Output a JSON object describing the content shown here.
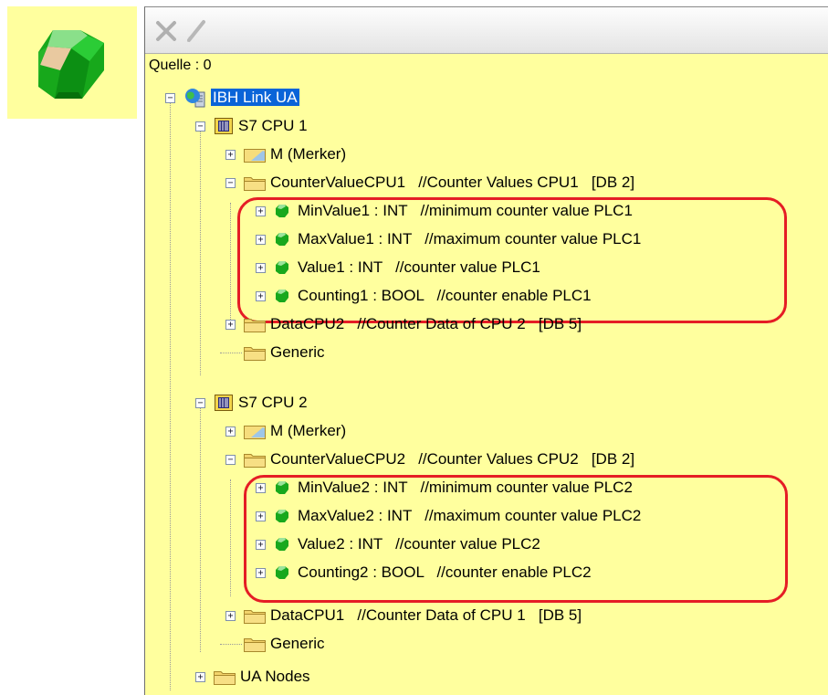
{
  "source": "Quelle : 0",
  "root": {
    "label": "IBH Link UA"
  },
  "cpu1": {
    "label": "S7 CPU 1",
    "merker": "M (Merker)",
    "db": "CounterValueCPU1   //Counter Values CPU1   [DB 2]",
    "vars": [
      "MinValue1 : INT   //minimum counter value PLC1",
      "MaxValue1 : INT   //maximum counter value PLC1",
      "Value1 : INT   //counter value PLC1",
      "Counting1 : BOOL   //counter enable PLC1"
    ],
    "data": "DataCPU2   //Counter Data of CPU 2   [DB 5]",
    "generic": "Generic"
  },
  "cpu2": {
    "label": "S7 CPU 2",
    "merker": "M (Merker)",
    "db": "CounterValueCPU2   //Counter Values CPU2   [DB 2]",
    "vars": [
      "MinValue2 : INT   //minimum counter value PLC2",
      "MaxValue2 : INT   //maximum counter value PLC2",
      "Value2 : INT   //counter value PLC2",
      "Counting2 : BOOL   //counter enable PLC2"
    ],
    "data": "DataCPU1   //Counter Data of CPU 1   [DB 5]",
    "generic": "Generic"
  },
  "ua_nodes": "UA Nodes",
  "colors": {
    "panel_bg": "#ffff9e",
    "highlight": "#e51d25",
    "selection": "#0a64d8"
  },
  "icons": {
    "toolbar": [
      "delete-icon",
      "edit-pencil-icon"
    ],
    "nodes": [
      "server-globe-icon",
      "cpu-icon",
      "folder-icon",
      "variable-icon"
    ]
  }
}
